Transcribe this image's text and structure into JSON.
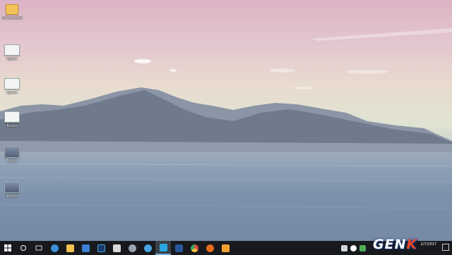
{
  "desktop": {
    "icons": [
      {
        "label": "Screenshots",
        "kind": "folder"
      },
      {
        "label": "Ryzen",
        "kind": "image"
      },
      {
        "label": "Ryzen",
        "kind": "image"
      },
      {
        "label": "Ryzen",
        "kind": "image"
      },
      {
        "label": "Ryzen",
        "kind": "image-dark"
      },
      {
        "label": "Ryzen",
        "kind": "image-dark"
      }
    ]
  },
  "taskbar": {
    "apps": [
      {
        "name": "start-button",
        "icon": "windows-logo-icon",
        "color": "#ffffff"
      },
      {
        "name": "search-button",
        "icon": "search-icon",
        "color": "#ffffff"
      },
      {
        "name": "task-view-button",
        "icon": "task-view-icon",
        "color": "#ffffff"
      },
      {
        "name": "edge-button",
        "icon": "edge-icon",
        "color": "#3b8fd8"
      },
      {
        "name": "file-explorer-button",
        "icon": "folder-icon",
        "color": "#f2c14e"
      },
      {
        "name": "store-button",
        "icon": "store-icon",
        "color": "#3a7fd4"
      },
      {
        "name": "photoshop-button",
        "icon": "photoshop-icon",
        "color": "#1b3a6b"
      },
      {
        "name": "photos-button",
        "icon": "photos-icon",
        "color": "#d9d9d9"
      },
      {
        "name": "steam-button",
        "icon": "steam-icon",
        "color": "#9aa4b1"
      },
      {
        "name": "app-button",
        "icon": "app-icon",
        "color": "#4aa3df"
      },
      {
        "name": "skype-button",
        "icon": "skype-icon",
        "color": "#2aa7e1"
      },
      {
        "name": "word-button",
        "icon": "word-icon",
        "color": "#2b579a"
      },
      {
        "name": "chrome-button",
        "icon": "chrome-icon",
        "color": "#e04a3a"
      },
      {
        "name": "firefox-button",
        "icon": "firefox-icon",
        "color": "#e66b1c"
      },
      {
        "name": "media-button",
        "icon": "media-icon",
        "color": "#f0a030"
      }
    ]
  },
  "tray": {
    "date": "2/7/2017"
  },
  "watermark": {
    "text_main": "GEN",
    "text_accent": "K",
    "accent_color": "#e8462c"
  }
}
